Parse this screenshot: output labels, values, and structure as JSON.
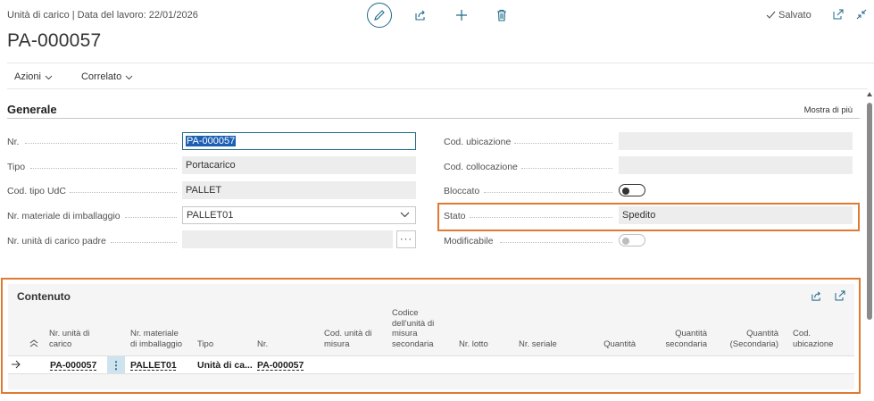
{
  "header": {
    "caption": "Unità di carico | Data del lavoro: 22/01/2026",
    "record_title": "PA-000057",
    "saved_label": "Salvato"
  },
  "actions": {
    "menu": [
      {
        "label": "Azioni"
      },
      {
        "label": "Correlato"
      }
    ]
  },
  "general": {
    "title": "Generale",
    "show_more": "Mostra di più",
    "left_fields": {
      "nr": {
        "label": "Nr.",
        "value": "PA-000057"
      },
      "tipo": {
        "label": "Tipo",
        "value": "Portacarico"
      },
      "cod_tipo": {
        "label": "Cod. tipo UdC",
        "value": "PALLET"
      },
      "materiale": {
        "label": "Nr. materiale di imballaggio",
        "value": "PALLET01"
      },
      "padre": {
        "label": "Nr. unità di carico padre",
        "value": ""
      }
    },
    "right_fields": {
      "ubicazione": {
        "label": "Cod. ubicazione",
        "value": ""
      },
      "collocazione": {
        "label": "Cod. collocazione",
        "value": ""
      },
      "bloccato": {
        "label": "Bloccato",
        "on": false
      },
      "stato": {
        "label": "Stato",
        "value": "Spedito"
      },
      "modificabile": {
        "label": "Modificabile",
        "on": false
      }
    }
  },
  "contenuto": {
    "title": "Contenuto",
    "columns": {
      "nr_udc": "Nr. unità di carico",
      "materiale": "Nr. materiale di imballaggio",
      "tipo": "Tipo",
      "nr": "Nr.",
      "um": "Cod. unità di misura",
      "um_sec": "Codice dell'unità di misura secondaria",
      "lotto": "Nr. lotto",
      "seriale": "Nr. seriale",
      "quantita": "Quantità",
      "qta_sec": "Quantità secondaria",
      "qta_sec2": "Quantità (Secondaria)",
      "ubicazione": "Cod. ubicazione"
    },
    "rows": [
      {
        "nr_udc": "PA-000057",
        "materiale": "PALLET01",
        "tipo": "Unità di ca...",
        "nr": "PA-000057"
      }
    ]
  },
  "colors": {
    "accent": "#1f6a8a",
    "highlight": "#e07a32"
  }
}
